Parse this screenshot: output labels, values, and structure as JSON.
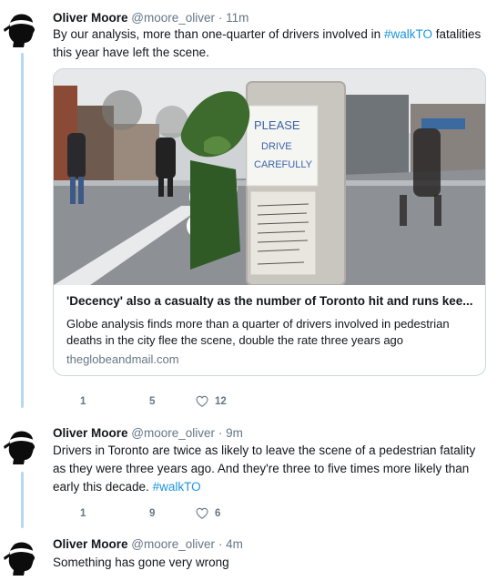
{
  "tweets": [
    {
      "name": "Oliver Moore",
      "handle": "@moore_oliver",
      "separator": "·",
      "time": "11m",
      "text_before": "By our analysis, more than one-quarter of drivers involved in ",
      "hashtag": "#walkTO",
      "text_after": " fatalities this year have left the scene.",
      "card": {
        "title": "'Decency' also a casualty as the number of Toronto hit and runs kee...",
        "description": "Globe analysis finds more than a quarter of drivers involved in pedestrian deaths in the city flee the scene, double the rate three years ago",
        "domain": "theglobeandmail.com",
        "sign_lines": [
          "PLEASE",
          "DRIVE",
          "CAREFULLY"
        ]
      },
      "actions": {
        "replies": "1",
        "retweets": "5",
        "likes": "12"
      }
    },
    {
      "name": "Oliver Moore",
      "handle": "@moore_oliver",
      "separator": "·",
      "time": "9m",
      "text_before": "Drivers in Toronto are twice as likely to leave the scene of a pedestrian fatality as they were three years ago. And they're three to five times more likely than early this decade. ",
      "hashtag": "#walkTO",
      "text_after": "",
      "actions": {
        "replies": "1",
        "retweets": "9",
        "likes": "6"
      }
    },
    {
      "name": "Oliver Moore",
      "handle": "@moore_oliver",
      "separator": "·",
      "time": "4m",
      "text_before": "Something has gone very wrong",
      "hashtag": "",
      "text_after": ""
    }
  ],
  "colors": {
    "thread_line": "#b8d8f0",
    "link": "#1b95e0",
    "muted": "#657786",
    "text": "#14171a"
  },
  "icons": [
    "reply-icon",
    "retweet-icon",
    "like-icon",
    "flag-avatar-icon"
  ]
}
